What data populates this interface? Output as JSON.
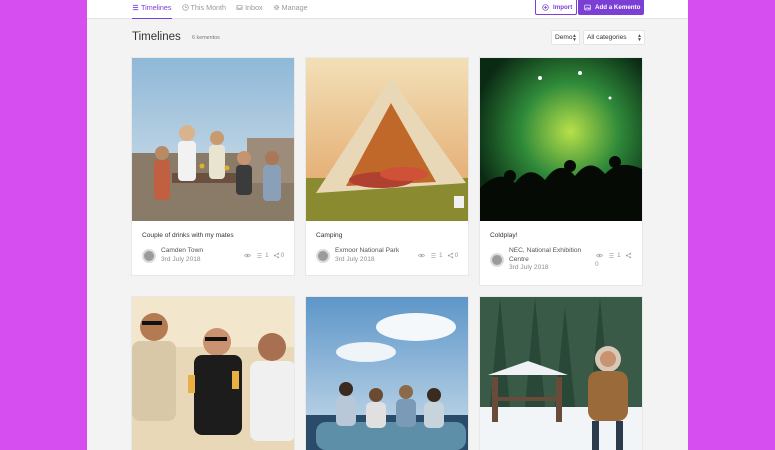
{
  "nav": {
    "items": [
      {
        "label": "Timelines",
        "icon": "list-icon",
        "active": true
      },
      {
        "label": "This Month",
        "icon": "clock-icon",
        "active": false
      },
      {
        "label": "Inbox",
        "icon": "inbox-icon",
        "active": false
      },
      {
        "label": "Manage",
        "icon": "gear-icon",
        "active": false
      }
    ]
  },
  "actions": {
    "import_label": "Import",
    "add_label": "Add a Kemento"
  },
  "page": {
    "title": "Timelines",
    "count": "6 kementos"
  },
  "filters": {
    "demo": "Demo",
    "category": "All categories"
  },
  "cards": [
    {
      "title": "Couple of drinks with my mates",
      "location": "Camden Town",
      "date": "3rd July 2018",
      "links": "1",
      "shares": "0"
    },
    {
      "title": "Camping",
      "location": "Exmoor National Park",
      "date": "3rd July 2018",
      "links": "1",
      "shares": "0"
    },
    {
      "title": "Coldplay!",
      "location_line1": "NEC, National Exhibition",
      "location_line2": "Centre",
      "date": "3rd July 2018",
      "links": "1",
      "shares": "0"
    }
  ],
  "colors": {
    "accent": "#7b3fd6",
    "background": "#d64df0",
    "sheet": "#f3f3f3"
  }
}
